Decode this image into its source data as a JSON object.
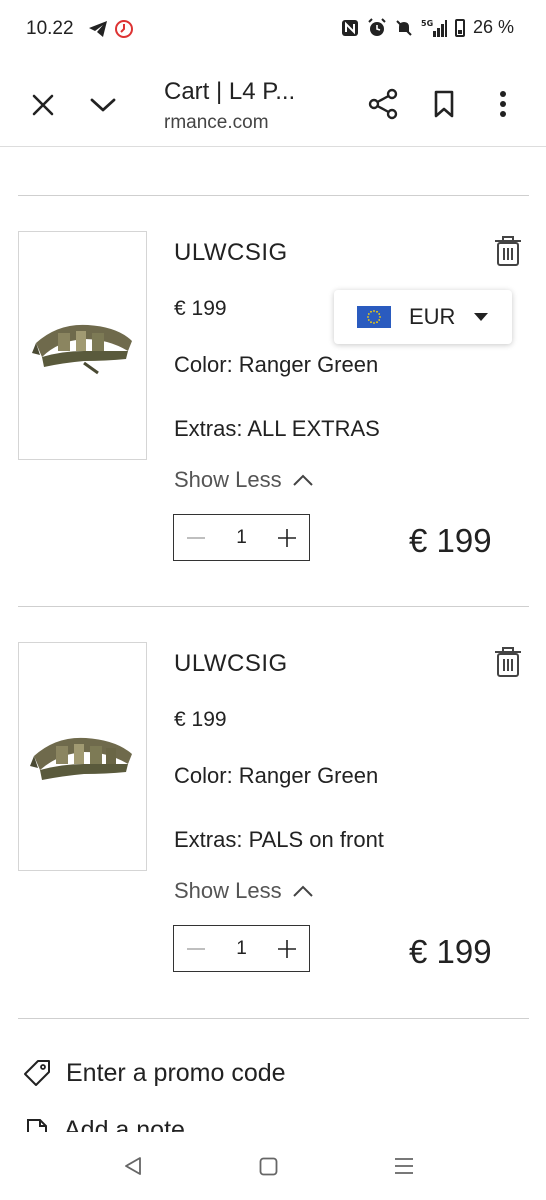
{
  "status_bar": {
    "time": "10.22",
    "battery": "26 %",
    "network": "5G"
  },
  "browser": {
    "tab_title": "Cart | L4 P...",
    "url": "rmance.com"
  },
  "currency": {
    "code": "EUR",
    "flag": "eu-flag-icon"
  },
  "cart_items": [
    {
      "name": "ULWCSIG",
      "price": "€ 199",
      "color": "Color: Ranger Green",
      "extras": "Extras: ALL EXTRAS",
      "toggle": "Show Less",
      "quantity": "1",
      "total": "€ 199"
    },
    {
      "name": "ULWCSIG",
      "price": "€ 199",
      "color": "Color: Ranger Green",
      "extras": "Extras: PALS on front",
      "toggle": "Show Less",
      "quantity": "1",
      "total": "€ 199"
    }
  ],
  "promo": {
    "label": "Enter a promo code"
  },
  "note": {
    "label": "Add a note"
  },
  "colors": {
    "text": "#222222",
    "divider": "#cfcfcf",
    "flag_blue": "#2a5bbf",
    "flag_star": "#ffd500"
  }
}
